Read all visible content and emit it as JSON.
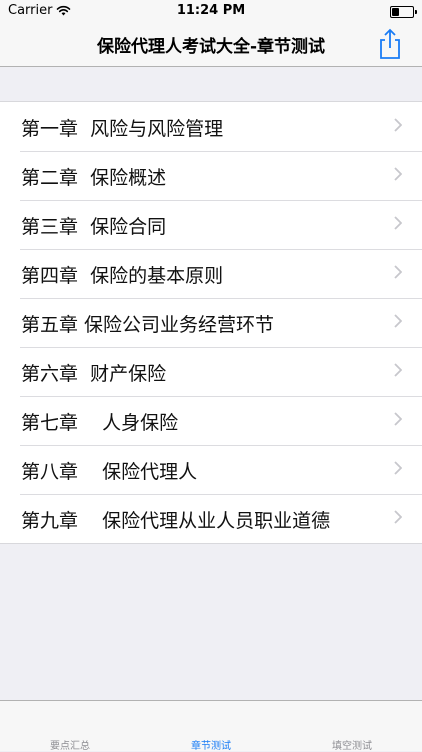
{
  "status_bar": {
    "carrier": "Carrier",
    "time": "11:24 PM"
  },
  "nav": {
    "title": "保险代理人考试大全-章节测试"
  },
  "chapters": [
    "第一章  风险与风险管理",
    "第二章  保险概述",
    "第三章  保险合同",
    "第四章  保险的基本原则",
    "第五章 保险公司业务经营环节",
    "第六章  财产保险",
    "第七章    人身保险",
    "第八章    保险代理人",
    "第九章    保险代理从业人员职业道德"
  ],
  "tabs": [
    {
      "label": "要点汇总",
      "active": false
    },
    {
      "label": "章节测试",
      "active": true
    },
    {
      "label": "填空测试",
      "active": false
    }
  ],
  "colors": {
    "accent": "#1a7cf5",
    "inactive_tab": "#8e8e93"
  }
}
